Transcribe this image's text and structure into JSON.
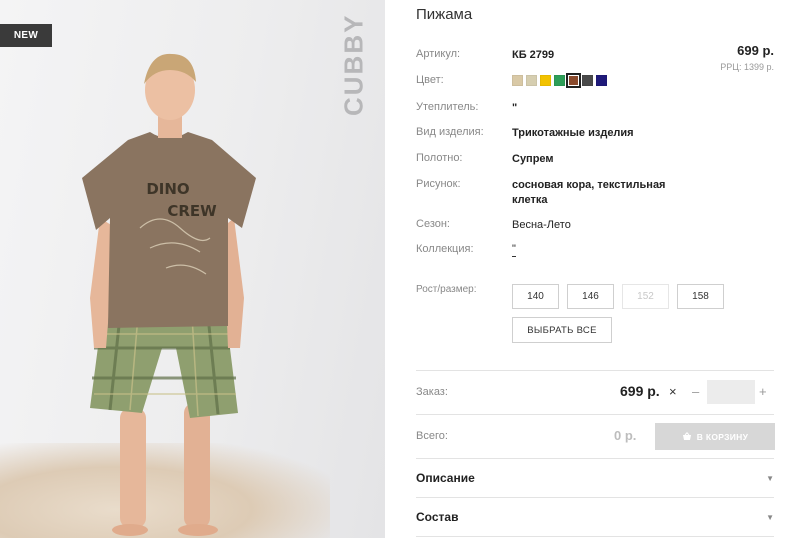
{
  "photo": {
    "badge": "NEW",
    "brand": "CUBBY",
    "shirt_print": [
      "DINO",
      "CREW"
    ]
  },
  "product": {
    "title": "Пижама",
    "price": "699 р.",
    "rrc": "РРЦ: 1399 р."
  },
  "specs": {
    "article": {
      "label": "Артикул:",
      "value": "КБ 2799"
    },
    "color": {
      "label": "Цвет:"
    },
    "insulation": {
      "label": "Утеплитель:",
      "value": "\""
    },
    "item_type": {
      "label": "Вид изделия:",
      "value": "Трикотажные изделия"
    },
    "fabric": {
      "label": "Полотно:",
      "value": "Супрем"
    },
    "pattern": {
      "label": "Рисунок:",
      "value_line1": "сосновая кора, текстильная",
      "value_line2": "клетка"
    },
    "season": {
      "label": "Сезон:",
      "value": "Весна-Лето"
    },
    "collection": {
      "label": "Коллекция:",
      "value": "\""
    }
  },
  "swatches": [
    {
      "color": "#d9c9a6"
    },
    {
      "color": "#d6ceb0"
    },
    {
      "color": "#f2c200"
    },
    {
      "color": "#2e9e58"
    },
    {
      "color": "#8a4a2c",
      "selected": true
    },
    {
      "color": "#4a4a4a"
    },
    {
      "color": "#1f1a7a"
    }
  ],
  "sizes": {
    "label": "Рост/размер:",
    "options": [
      {
        "value": "140",
        "available": true
      },
      {
        "value": "146",
        "available": true
      },
      {
        "value": "152",
        "available": false
      },
      {
        "value": "158",
        "available": true
      }
    ],
    "select_all": "ВЫБРАТЬ ВСЕ"
  },
  "order": {
    "label": "Заказ:",
    "price": "699 р.",
    "times": "×",
    "minus": "–",
    "plus": "+",
    "quantity": ""
  },
  "total": {
    "label": "Всего:",
    "value": "0 р.",
    "cart_button": "В КОРЗИНУ"
  },
  "accordion": [
    {
      "title": "Описание"
    },
    {
      "title": "Состав"
    }
  ],
  "colors": {
    "accent_dark": "#3a3a3a",
    "disabled_button": "#d7d7d7",
    "selected_swatch": "#8a4a2c"
  }
}
